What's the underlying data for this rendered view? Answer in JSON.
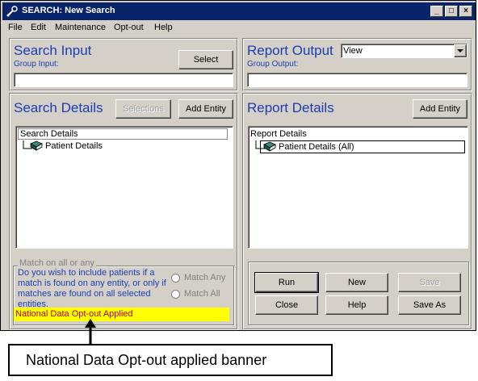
{
  "window": {
    "title": "SEARCH: New Search",
    "controls": {
      "minimize": "_",
      "maximize": "□",
      "close": "×"
    }
  },
  "menu": [
    "File",
    "Edit",
    "Maintenance",
    "Opt-out",
    "Help"
  ],
  "search_input": {
    "heading": "Search Input",
    "group_label": "Group Input:",
    "select_button": "Select",
    "group_value": ""
  },
  "report_output": {
    "heading": "Report Output",
    "group_label": "Group Output:",
    "dropdown_value": "View",
    "group_value": ""
  },
  "search_details": {
    "heading": "Search Details",
    "selections_button": "Selections",
    "add_entity_button": "Add Entity",
    "tree_root": "Search Details",
    "tree_items": [
      "Patient Details"
    ]
  },
  "report_details": {
    "heading": "Report Details",
    "add_entity_button": "Add Entity",
    "tree_root": "Report Details",
    "tree_items": [
      "Patient Details (All)"
    ]
  },
  "match": {
    "title": "Match on all or any",
    "description": "Do you wish to include patients if a match is found on any entity, or only if matches are found on all selected entities.",
    "option_any": "Match Any",
    "option_all": "Match All",
    "banner": "National Data Opt-out Applied"
  },
  "actions": {
    "run": "Run",
    "new": "New",
    "save": "Save",
    "close": "Close",
    "help": "Help",
    "save_as": "Save As"
  },
  "annotation": {
    "callout": "National Data Opt-out applied banner"
  },
  "colors": {
    "title_bar": "#0a246a",
    "heading": "#1c3db3",
    "banner_bg": "#ffff00",
    "banner_text": "#c00000"
  }
}
